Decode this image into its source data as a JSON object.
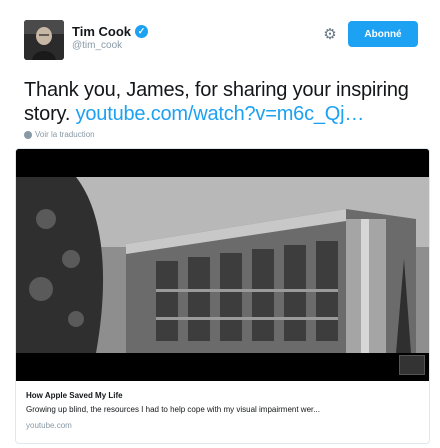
{
  "header": {
    "display_name": "Tim Cook",
    "verified_icon": "verified-badge-icon",
    "handle": "@tim_cook",
    "gear_icon": "gear-icon",
    "follow_label": "Abonné"
  },
  "tweet": {
    "text": "Thank you, James, for sharing your inspiring story.",
    "link": "youtube.com/watch?v=m6c_Qj…"
  },
  "translate": {
    "icon": "globe-icon",
    "label": "Voir la traduction"
  },
  "card": {
    "title": "How Apple Saved My Life",
    "description": "Growing up blind, the resources I had to help cope with my visual impairment wer...",
    "domain": "youtube.com"
  },
  "colors": {
    "accent": "#1da1f2",
    "muted": "#8899a6",
    "text": "#14171a",
    "border": "#e1e8ed"
  }
}
